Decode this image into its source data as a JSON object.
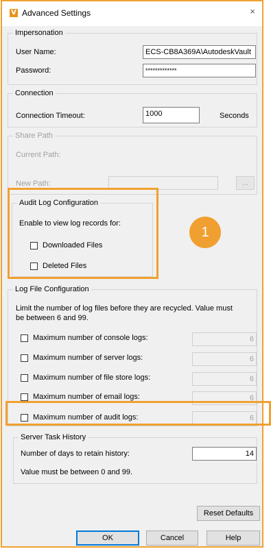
{
  "window": {
    "title": "Advanced Settings",
    "close_glyph": "×"
  },
  "impersonation": {
    "legend": "Impersonation",
    "user_name_label": "User Name:",
    "user_name_value": "ECS-CB8A369A\\AutodeskVault",
    "password_label": "Password:",
    "password_value": "*************"
  },
  "connection": {
    "legend": "Connection",
    "timeout_label": "Connection Timeout:",
    "timeout_value": "1000",
    "unit": "Seconds"
  },
  "share_path": {
    "legend": "Share Path",
    "current_path_label": "Current Path:",
    "new_path_label": "New Path:",
    "new_path_value": "",
    "browse_label": "..."
  },
  "audit_log": {
    "legend": "Audit Log Configuration",
    "description": "Enable to view log records for:",
    "options": [
      {
        "label": "Downloaded Files",
        "checked": false
      },
      {
        "label": "Deleted Files",
        "checked": false
      }
    ]
  },
  "callout": {
    "number": "1"
  },
  "log_file": {
    "legend": "Log File Configuration",
    "description_line1": "Limit the number of log files before they are recycled. Value must",
    "description_line2": "be between 6 and 99.",
    "rows": [
      {
        "label": "Maximum number of console logs:",
        "value": "6",
        "checked": false
      },
      {
        "label": "Maximum number of server logs:",
        "value": "6",
        "checked": false
      },
      {
        "label": "Maximum number of file store logs:",
        "value": "6",
        "checked": false
      },
      {
        "label": "Maximum number of email logs:",
        "value": "6",
        "checked": false
      },
      {
        "label": "Maximum number of audit logs:",
        "value": "6",
        "checked": false
      }
    ]
  },
  "server_task": {
    "legend": "Server Task History",
    "days_label": "Number of days to retain history:",
    "days_value": "14",
    "note": "Value must be between 0 and 99."
  },
  "buttons": {
    "reset_defaults": "Reset Defaults",
    "ok": "OK",
    "cancel": "Cancel",
    "help": "Help"
  },
  "colors": {
    "highlight": "#f0a030",
    "title_icon": "#e8941a"
  }
}
